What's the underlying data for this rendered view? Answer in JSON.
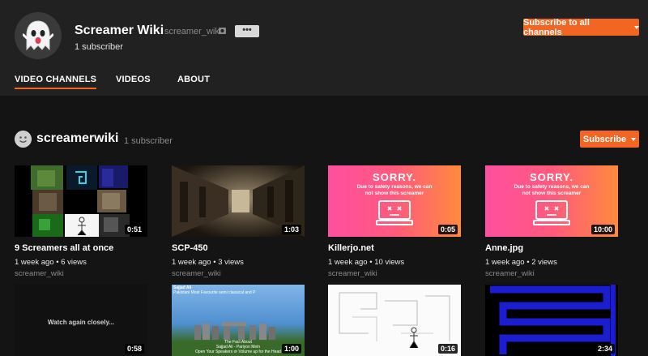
{
  "channel": {
    "title": "Screamer Wiki",
    "handle": "screamer_wiki",
    "more_label": "•••",
    "subscribers": "1 subscriber",
    "subscribe_all_label": "Subscribe to all channels"
  },
  "tabs": [
    {
      "label": "VIDEO CHANNELS",
      "active": true
    },
    {
      "label": "VIDEOS",
      "active": false
    },
    {
      "label": "ABOUT",
      "active": false
    }
  ],
  "section": {
    "title": "screamerwiki",
    "subscribers": "1 subscriber",
    "subscribe_label": "Subscribe"
  },
  "videos": [
    {
      "title": "9 Screamers all at once",
      "meta": "1 week ago • 6 views",
      "channel": "screamer_wiki",
      "duration": "0:51"
    },
    {
      "title": "SCP-450",
      "meta": "1 week ago • 3 views",
      "channel": "screamer_wiki",
      "duration": "1:03"
    },
    {
      "title": "Killerjo.net",
      "meta": "1 week ago • 10 views",
      "channel": "screamer_wiki",
      "duration": "0:05",
      "sorry_title": "SORRY.",
      "sorry_text": "Due to safety reasons, we can not show this screamer"
    },
    {
      "title": "Anne.jpg",
      "meta": "1 week ago • 2 views",
      "channel": "screamer_wiki",
      "duration": "10:00",
      "sorry_title": "SORRY.",
      "sorry_text": "Due to safety reasons, we can not show this screamer"
    },
    {
      "duration": "0:58",
      "overlay": "Watch again closely..."
    },
    {
      "duration": "1:00",
      "overlay_lines": [
        "Sajjad Ali",
        "Pakistani Most Favourite semi classical and P",
        "The Fact About",
        "Sajjad Ali - Pariyon Mein",
        "Open Your Speakers or Volume up for the Head"
      ]
    },
    {
      "duration": "0:16"
    },
    {
      "duration": "2:34"
    }
  ],
  "colors": {
    "accent": "#f26522",
    "header_bg": "#212121",
    "page_bg": "#141414"
  }
}
